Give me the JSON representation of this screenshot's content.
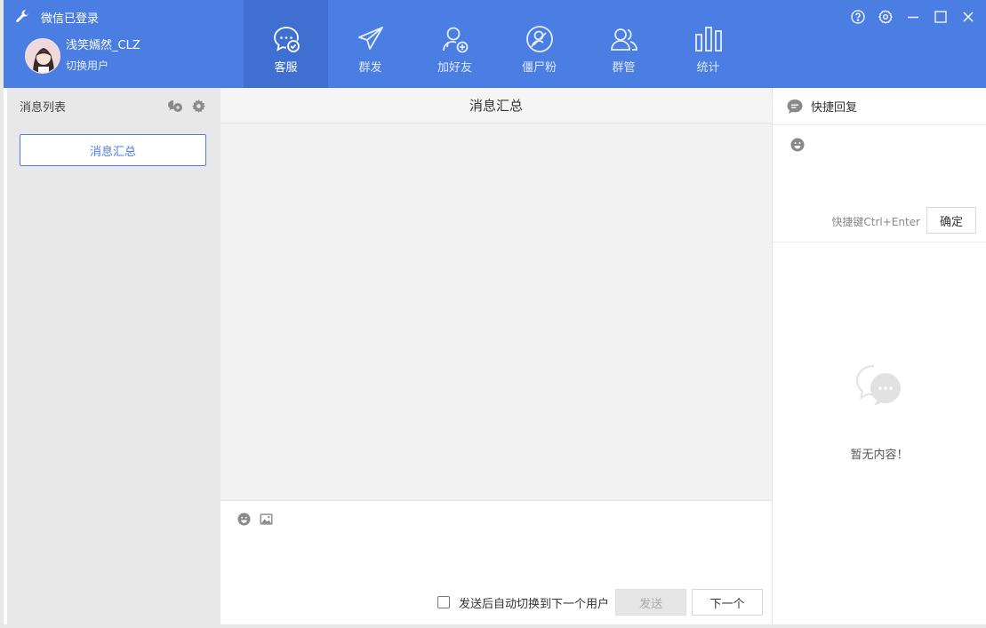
{
  "window": {
    "status_title": "微信已登录",
    "accent_color": "#4b7ee2"
  },
  "user": {
    "name": "浅笑嫣然_CLZ",
    "switch_label": "切换用户"
  },
  "nav": {
    "items": [
      {
        "label": "客服",
        "icon": "chat-check-icon",
        "active": true
      },
      {
        "label": "群发",
        "icon": "paper-plane-icon",
        "active": false
      },
      {
        "label": "加好友",
        "icon": "add-friend-icon",
        "active": false
      },
      {
        "label": "僵尸粉",
        "icon": "zombie-fans-icon",
        "active": false
      },
      {
        "label": "群管",
        "icon": "group-icon",
        "active": false
      },
      {
        "label": "统计",
        "icon": "bar-stats-icon",
        "active": false
      }
    ]
  },
  "window_controls": [
    "help-icon",
    "settings-icon",
    "minimize-icon",
    "maximize-icon",
    "close-icon"
  ],
  "left_panel": {
    "title": "消息列表",
    "summary_button": "消息汇总"
  },
  "center_panel": {
    "title": "消息汇总",
    "auto_switch_label": "发送后自动切换到下一个用户",
    "send_label": "发送",
    "next_label": "下一个"
  },
  "right_panel": {
    "title": "快捷回复",
    "shortcut_hint": "快捷键Ctrl+Enter",
    "confirm_label": "确定",
    "empty_text": "暂无内容！"
  }
}
